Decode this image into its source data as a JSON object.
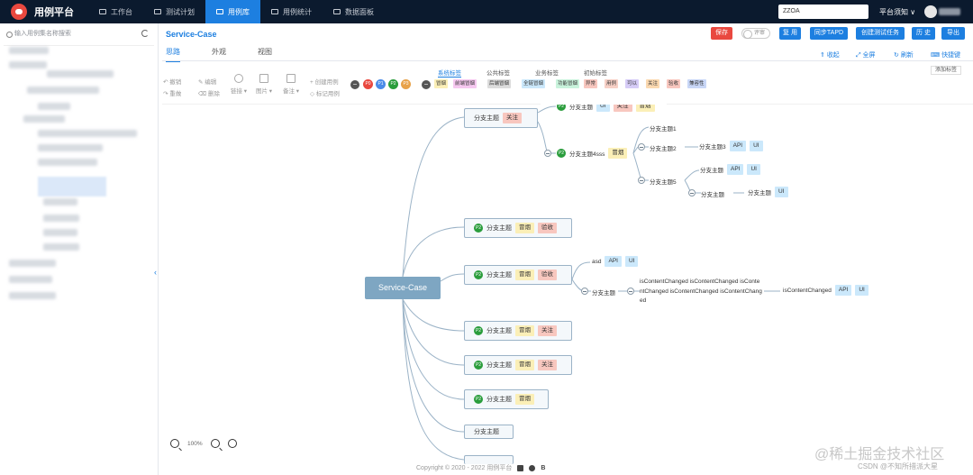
{
  "app": {
    "title": "用例平台"
  },
  "nav": [
    {
      "label": "工作台",
      "active": false
    },
    {
      "label": "测试计划",
      "active": false
    },
    {
      "label": "用例库",
      "active": true
    },
    {
      "label": "用例统计",
      "active": false
    },
    {
      "label": "数据面板",
      "active": false
    }
  ],
  "topbar": {
    "project": "ZZOA",
    "notice": "平台须知 ∨"
  },
  "sidebar": {
    "search_placeholder": "输入用例集名称搜索"
  },
  "case": {
    "title": "Service-Case"
  },
  "actions": {
    "save": "保存",
    "review": "评审",
    "copy": "复 用",
    "sync": "同步TAPD",
    "create_task": "创建测试任务",
    "history": "历 史",
    "export": "导出"
  },
  "tabs": [
    "思路",
    "外观",
    "视图"
  ],
  "right_actions": {
    "collapse": "收起",
    "fullscreen": "全屏",
    "refresh": "刷新",
    "shortcut": "快捷键"
  },
  "toolbar": {
    "undo": "撤销",
    "redo": "重做",
    "edit": "编辑",
    "delete": "删除",
    "link": "链接",
    "image": "图片",
    "note": "备注",
    "create_case": "创建用例",
    "mark_case": "标记用例"
  },
  "priorities": [
    "P0",
    "P1",
    "P2",
    "P3"
  ],
  "tag_tabs": [
    "系统标签",
    "公共标签",
    "业务标签",
    "初始标签"
  ],
  "add_tag": "添加标签",
  "tags": [
    "冒烟",
    "前端冒烟",
    "后端冒烟",
    "全链冒烟",
    "功能冒烟",
    "异常",
    "用例",
    "可以",
    "关注",
    "验收",
    "兼容性"
  ],
  "mindmap": {
    "root": "Service-Case",
    "branch": "分支主题",
    "branch4sss": "分支主题4sss",
    "branch1": "分支主题1",
    "branch2": "分支主题2",
    "branch3": "分支主题3",
    "branch5": "分支主题5",
    "tag_focus": "关注",
    "tag_smoke": "冒烟",
    "tag_accept": "验收",
    "tag_api": "API",
    "tag_ui": "UI",
    "p2": "P2",
    "asd": "asd",
    "long_text": "isContentChanged isContentChanged isContentChanged isContentChanged isContentChanged",
    "long_short": "isContentChanged"
  },
  "zoom": {
    "value": "100%"
  },
  "footer": {
    "copyright": "Copyright © 2020 - 2022 用例平台",
    "ico_b": "B"
  },
  "watermark": {
    "main": "@稀土掘金技术社区",
    "sub": "CSDN @不知所措派大星"
  }
}
